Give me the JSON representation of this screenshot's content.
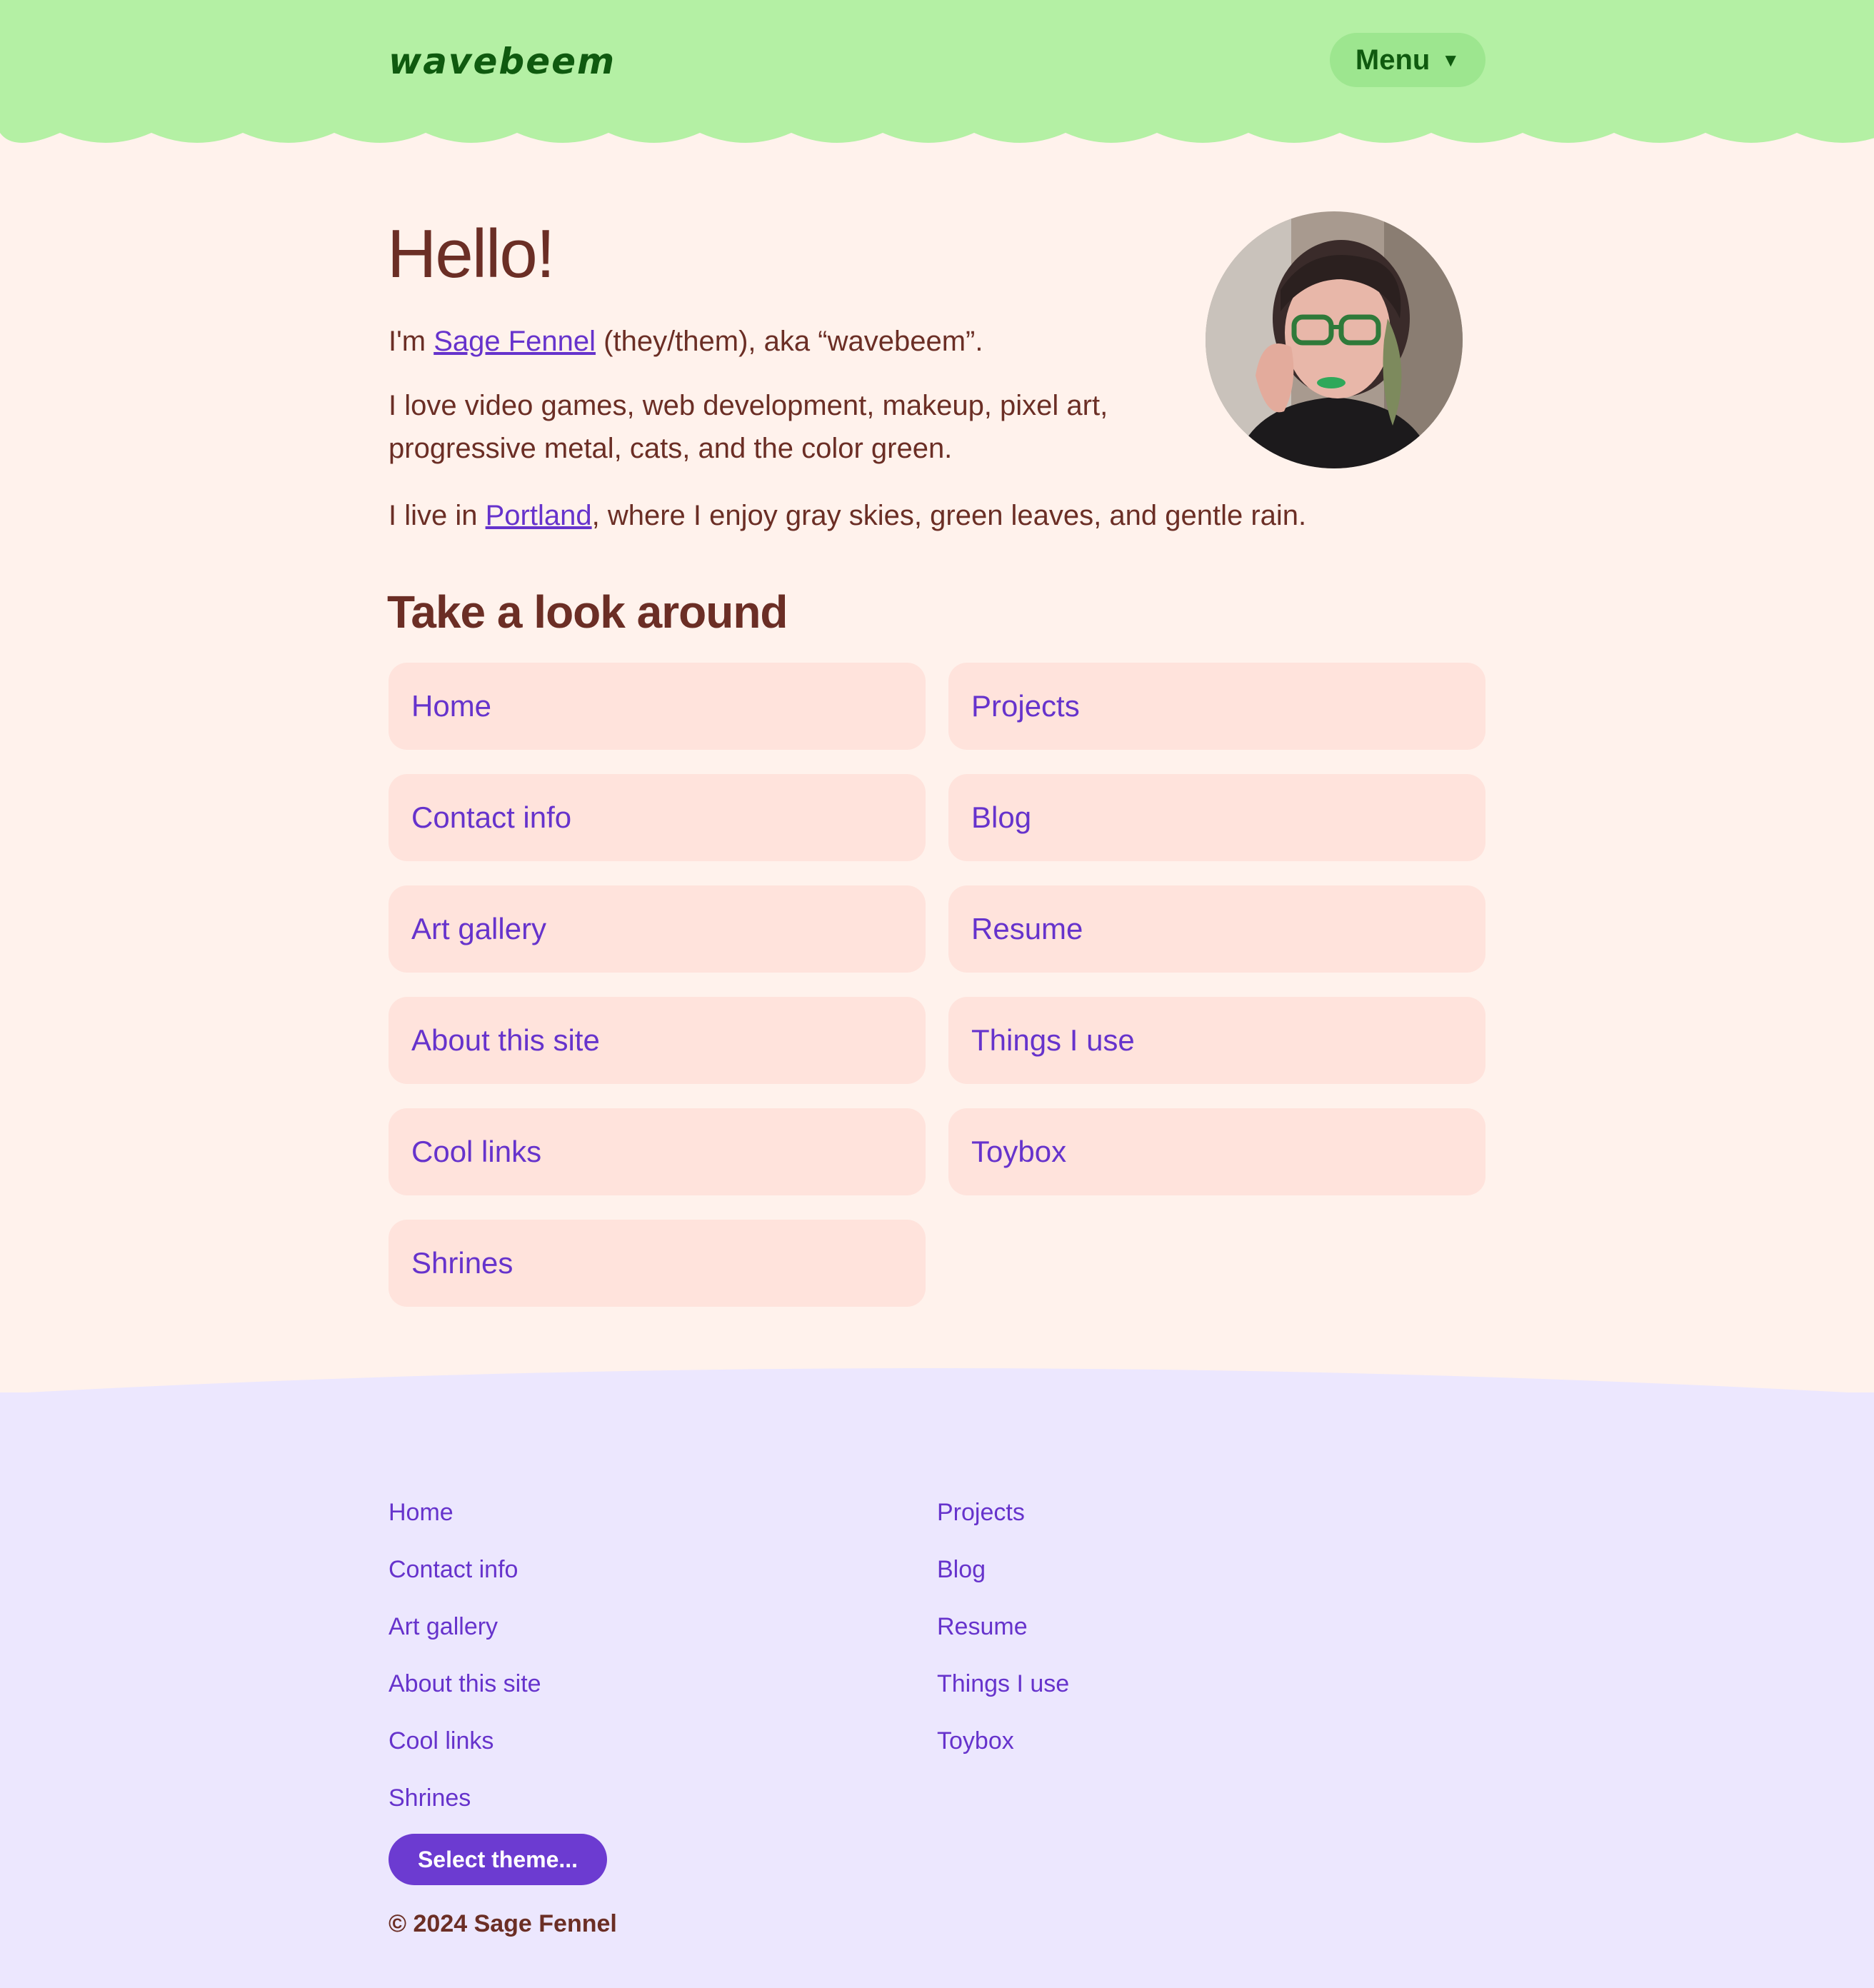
{
  "site": {
    "logo": "wavebeem",
    "menu_label": "Menu",
    "menu_caret_icon": "caret-down-icon"
  },
  "colors": {
    "header_bg": "#b4f0a4",
    "page_bg": "#fff2ec",
    "text": "#6b2e25",
    "link": "#6633cc",
    "tile_bg": "#ffe3dc",
    "footer_bg": "#ece7fe",
    "button_bg": "#6c3bd1"
  },
  "intro": {
    "heading": "Hello!",
    "p1_before": "I'm ",
    "p1_link": "Sage Fennel",
    "p1_after": " (they/them), aka “wavebeem”.",
    "p2": "I love video games, web development, makeup, pixel art, progressive metal, cats, and the color green.",
    "p3_before": "I live in ",
    "p3_link": "Portland",
    "p3_after": ", where I enjoy gray skies, green leaves, and gentle rain."
  },
  "look_around": {
    "heading": "Take a look around",
    "links": [
      "Home",
      "Projects",
      "Contact info",
      "Blog",
      "Art gallery",
      "Resume",
      "About this site",
      "Things I use",
      "Cool links",
      "Toybox",
      "Shrines"
    ]
  },
  "footer": {
    "left_links": [
      "Home",
      "Contact info",
      "Art gallery",
      "About this site",
      "Cool links",
      "Shrines"
    ],
    "right_links": [
      "Projects",
      "Blog",
      "Resume",
      "Things I use",
      "Toybox"
    ],
    "theme_button": "Select theme...",
    "copyright": "© 2024 Sage Fennel"
  }
}
